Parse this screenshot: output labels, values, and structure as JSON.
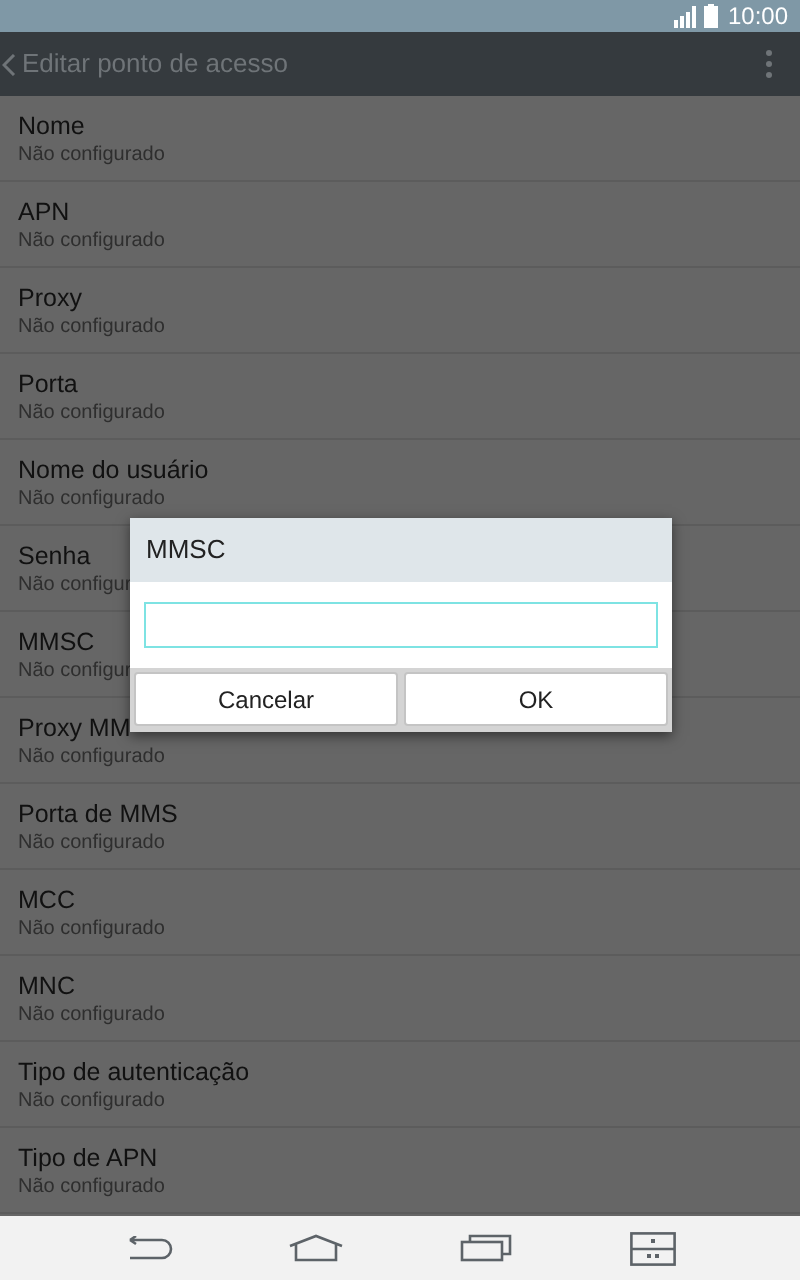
{
  "status_bar": {
    "time": "10:00"
  },
  "action_bar": {
    "title": "Editar ponto de acesso"
  },
  "settings": [
    {
      "title": "Nome",
      "value": "Não configurado"
    },
    {
      "title": "APN",
      "value": "Não configurado"
    },
    {
      "title": "Proxy",
      "value": "Não configurado"
    },
    {
      "title": "Porta",
      "value": "Não configurado"
    },
    {
      "title": "Nome do usuário",
      "value": "Não configurado"
    },
    {
      "title": "Senha",
      "value": "Não configur"
    },
    {
      "title": "MMSC",
      "value": "Não configur"
    },
    {
      "title": "Proxy MM",
      "value": "Não configurado"
    },
    {
      "title": "Porta de MMS",
      "value": "Não configurado"
    },
    {
      "title": "MCC",
      "value": "Não configurado"
    },
    {
      "title": "MNC",
      "value": "Não configurado"
    },
    {
      "title": "Tipo de autenticação",
      "value": "Não configurado"
    },
    {
      "title": "Tipo de APN",
      "value": "Não configurado"
    }
  ],
  "dialog": {
    "title": "MMSC",
    "buttons": [
      "Cancelar",
      "OK"
    ]
  }
}
